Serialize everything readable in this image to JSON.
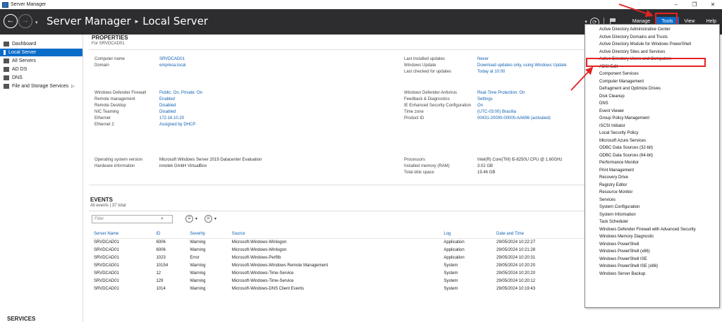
{
  "window": {
    "title": "Server Manager",
    "controls": [
      "–",
      "❐",
      "✕"
    ]
  },
  "header": {
    "app": "Server Manager",
    "page": "Local Server",
    "menus": [
      "Manage",
      "Tools",
      "View",
      "Help"
    ],
    "active_menu": "Tools"
  },
  "sidebar": {
    "items": [
      {
        "label": "Dashboard",
        "selected": false
      },
      {
        "label": "Local Server",
        "selected": true
      },
      {
        "label": "All Servers",
        "selected": false
      },
      {
        "label": "AD DS",
        "selected": false
      },
      {
        "label": "DNS",
        "selected": false
      },
      {
        "label": "File and Storage Services",
        "selected": false,
        "chevron": "▷"
      }
    ]
  },
  "properties": {
    "title": "PROPERTIES",
    "subtitle": "For SRVDCAD01",
    "group1_left": [
      {
        "k": "Computer name",
        "v": "SRVDCAD01"
      },
      {
        "k": "Domain",
        "v": "empresa.local"
      }
    ],
    "group1_right": [
      {
        "k": "Last installed updates",
        "v": "Never"
      },
      {
        "k": "Windows Update",
        "v": "Download updates only, using Windows Update"
      },
      {
        "k": "Last checked for updates",
        "v": "Today at 10:00"
      }
    ],
    "group2_left": [
      {
        "k": "Windows Defender Firewall",
        "v": "Public: On, Private: On"
      },
      {
        "k": "Remote management",
        "v": "Enabled"
      },
      {
        "k": "Remote Desktop",
        "v": "Disabled"
      },
      {
        "k": "NIC Teaming",
        "v": "Disabled"
      },
      {
        "k": "Ethernet",
        "v": "172.16.10.20"
      },
      {
        "k": "Ethernet 2",
        "v": "Assigned by DHCP"
      }
    ],
    "group2_right": [
      {
        "k": "Windows Defender Antivirus",
        "v": "Real-Time Protection: On"
      },
      {
        "k": "Feedback & Diagnostics",
        "v": "Settings"
      },
      {
        "k": "IE Enhanced Security Configuration",
        "v": "On"
      },
      {
        "k": "Time zone",
        "v": "(UTC-03:00) Brasília"
      },
      {
        "k": "Product ID",
        "v": "00431-20000-00000-AA696 (activated)"
      }
    ],
    "group3_left": [
      {
        "k": "Operating system version",
        "v": "Microsoft Windows Server 2019 Datacenter Evaluation"
      },
      {
        "k": "Hardware information",
        "v": "innotek GmbH VirtualBox"
      }
    ],
    "group3_right": [
      {
        "k": "Processors",
        "v": "Intel(R) Core(TM) i5-8250U CPU @ 1.60GHz"
      },
      {
        "k": "Installed memory (RAM)",
        "v": "3.02 GB"
      },
      {
        "k": "Total disk space",
        "v": "19.46 GB"
      }
    ]
  },
  "events": {
    "title": "EVENTS",
    "subtitle": "All events | 37 total",
    "filter_placeholder": "Filter",
    "columns": [
      "Server Name",
      "ID",
      "Severity",
      "Source",
      "Log",
      "Date and Time"
    ],
    "rows": [
      [
        "SRVDCAD01",
        "6006",
        "Warning",
        "Microsoft-Windows-Winlogon",
        "Application",
        "29/05/2024 10:22:27"
      ],
      [
        "SRVDCAD01",
        "6006",
        "Warning",
        "Microsoft-Windows-Winlogon",
        "Application",
        "29/05/2024 10:21:28"
      ],
      [
        "SRVDCAD01",
        "1023",
        "Error",
        "Microsoft-Windows-Perflib",
        "Application",
        "29/05/2024 10:20:31"
      ],
      [
        "SRVDCAD01",
        "10154",
        "Warning",
        "Microsoft-Windows-Windows Remote Management",
        "System",
        "29/05/2024 10:20:20"
      ],
      [
        "SRVDCAD01",
        "12",
        "Warning",
        "Microsoft-Windows-Time-Service",
        "System",
        "29/05/2024 10:20:20"
      ],
      [
        "SRVDCAD01",
        "129",
        "Warning",
        "Microsoft-Windows-Time-Service",
        "System",
        "29/05/2024 10:20:12"
      ],
      [
        "SRVDCAD01",
        "1014",
        "Warning",
        "Microsoft-Windows-DNS Client Events",
        "System",
        "29/05/2024 10:19:43"
      ]
    ]
  },
  "services": {
    "title": "SERVICES"
  },
  "tools_menu": {
    "items": [
      "Active Directory Administrative Center",
      "Active Directory Domains and Trusts",
      "Active Directory Module for Windows PowerShell",
      "Active Directory Sites and Services",
      "Active Directory Users and Computers",
      "ADSI Edit",
      "Component Services",
      "Computer Management",
      "Defragment and Optimize Drives",
      "Disk Cleanup",
      "DNS",
      "Event Viewer",
      "Group Policy Management",
      "iSCSI Initiator",
      "Local Security Policy",
      "Microsoft Azure Services",
      "ODBC Data Sources (32-bit)",
      "ODBC Data Sources (64-bit)",
      "Performance Monitor",
      "Print Management",
      "Recovery Drive",
      "Registry Editor",
      "Resource Monitor",
      "Services",
      "System Configuration",
      "System Information",
      "Task Scheduler",
      "Windows Defender Firewall with Advanced Security",
      "Windows Memory Diagnostic",
      "Windows PowerShell",
      "Windows PowerShell (x86)",
      "Windows PowerShell ISE",
      "Windows PowerShell ISE (x86)",
      "Windows Server Backup"
    ],
    "highlighted": "Active Directory Users and Computers"
  },
  "colors": {
    "header_bg": "#2d2d30",
    "accent": "#0a6cc9",
    "link": "#1061b3",
    "annotation": "#e32222"
  }
}
